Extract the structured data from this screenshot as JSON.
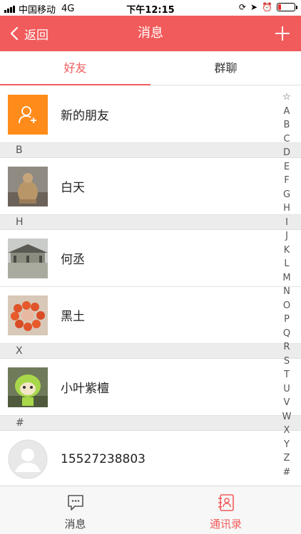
{
  "status_bar": {
    "carrier": "中国移动",
    "network": "4G",
    "time": "下午12:15",
    "battery_level": 0.2
  },
  "nav": {
    "back_label": "返回",
    "title": "消息",
    "add_icon": "plus-icon"
  },
  "tabs": [
    {
      "label": "好友",
      "active": true
    },
    {
      "label": "群聊",
      "active": false
    }
  ],
  "new_friend": {
    "label": "新的朋友",
    "icon": "add-user-icon"
  },
  "sections": [
    {
      "letter": "B",
      "contacts": [
        {
          "name": "白天"
        }
      ]
    },
    {
      "letter": "H",
      "contacts": [
        {
          "name": "何丞"
        },
        {
          "name": "黑土"
        }
      ]
    },
    {
      "letter": "X",
      "contacts": [
        {
          "name": "小叶紫檀"
        }
      ]
    },
    {
      "letter": "#",
      "contacts": [
        {
          "name": "15527238803"
        }
      ]
    }
  ],
  "index_bar": [
    "☆",
    "A",
    "B",
    "C",
    "D",
    "E",
    "F",
    "G",
    "H",
    "I",
    "J",
    "K",
    "L",
    "M",
    "N",
    "O",
    "P",
    "Q",
    "R",
    "S",
    "T",
    "U",
    "V",
    "W",
    "X",
    "Y",
    "Z",
    "#"
  ],
  "tabbar": [
    {
      "label": "消息",
      "icon": "chat-icon",
      "active": false
    },
    {
      "label": "通讯录",
      "icon": "contacts-icon",
      "active": true
    }
  ],
  "colors": {
    "accent": "#f25b5b",
    "orange": "#ff8c1a"
  }
}
